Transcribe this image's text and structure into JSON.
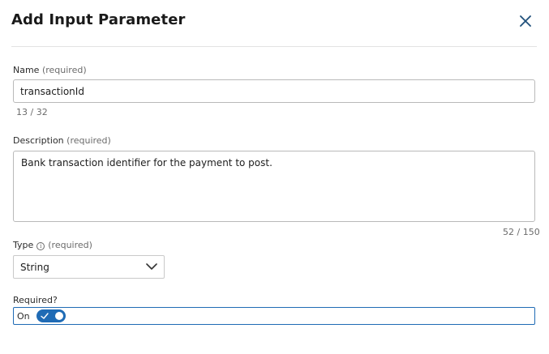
{
  "dialog": {
    "title": "Add Input Parameter"
  },
  "name_field": {
    "label": "Name",
    "required_tag": "(required)",
    "value": "transactionId",
    "counter": "13 / 32"
  },
  "description_field": {
    "label": "Description",
    "required_tag": "(required)",
    "value": "Bank transaction identifier for the payment to post.",
    "counter": "52 / 150"
  },
  "type_field": {
    "label": "Type",
    "required_tag": "(required)",
    "selected": "String",
    "info_icon": "info-icon"
  },
  "required_field": {
    "label": "Required?",
    "toggle_state_label": "On",
    "checked": true
  },
  "colors": {
    "accent": "#1f6bb5",
    "close_icon": "#1f4f7a",
    "border": "#b9b9b9"
  }
}
